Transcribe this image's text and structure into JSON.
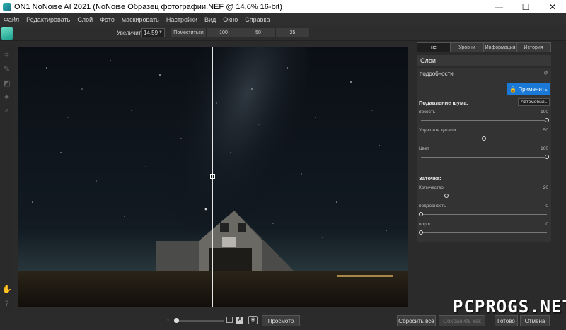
{
  "window": {
    "title": "ON1 NoNoise AI 2021 (NoNoise Образец фотографии.NEF @ 14.6% 16-bit)",
    "controls": [
      "—",
      "☐",
      "✕"
    ]
  },
  "menu": [
    "Файл",
    "Редактировать",
    "Слой",
    "Фото",
    "маскировать",
    "Настройки",
    "Вид",
    "Окно",
    "Справка"
  ],
  "toolbar": {
    "zoom_label": "Увеличить",
    "zoom_value": "14,59",
    "zoom_presets": [
      "Поместиться",
      "100",
      "50",
      "25"
    ]
  },
  "panel": {
    "tabs": [
      "не",
      "Уровни",
      "Информация",
      "История"
    ],
    "layers_title": "Слои",
    "section_title": "подробности",
    "apply_button": "Применить",
    "noise_title": "Подавление шума:",
    "auto_button": "Автомобиль",
    "noise_sliders": [
      {
        "label": "яркость",
        "value": "100",
        "fraction": 1.0
      },
      {
        "label": "Улучшить детали",
        "value": "50",
        "fraction": 0.5
      },
      {
        "label": "Цвет",
        "value": "100",
        "fraction": 1.0
      }
    ],
    "sharpen_title": "Заточка:",
    "sharpen_sliders": [
      {
        "label": "Количество",
        "value": "20",
        "fraction": 0.2
      },
      {
        "label": "подробность",
        "value": "0",
        "fraction": 0.0
      },
      {
        "label": "порог",
        "value": "0",
        "fraction": 0.0
      }
    ]
  },
  "bottom": {
    "preview_button": "Просмотр",
    "reset_button": "Сбросить все",
    "save_button": "Сохранить как",
    "done_button": "Готово",
    "cancel_button": "Отмена"
  },
  "watermark": "PCPROGS.NET"
}
